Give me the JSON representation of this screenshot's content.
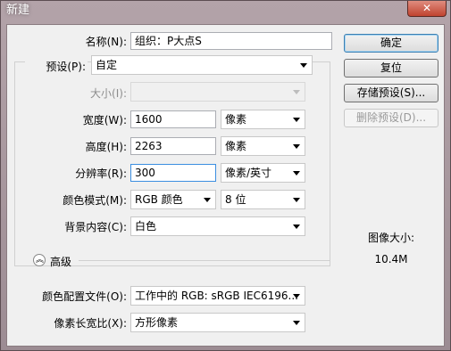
{
  "window": {
    "title": "新建",
    "close_glyph": "✕"
  },
  "fields": {
    "name": {
      "label": "名称(N):",
      "value": "组织：P大点S"
    },
    "preset": {
      "label": "预设(P):",
      "value": "自定"
    },
    "size": {
      "label": "大小(I):",
      "value": ""
    },
    "width": {
      "label": "宽度(W):",
      "value": "1600",
      "unit": "像素"
    },
    "height": {
      "label": "高度(H):",
      "value": "2263",
      "unit": "像素"
    },
    "resolution": {
      "label": "分辨率(R):",
      "value": "300",
      "unit": "像素/英寸"
    },
    "color_mode": {
      "label": "颜色模式(M):",
      "mode": "RGB 颜色",
      "depth": "8 位"
    },
    "background": {
      "label": "背景内容(C):",
      "value": "白色"
    },
    "advanced": {
      "label": "高级"
    },
    "color_profile": {
      "label": "颜色配置文件(O):",
      "value": "工作中的 RGB: sRGB IEC6196..."
    },
    "pixel_aspect": {
      "label": "像素长宽比(X):",
      "value": "方形像素"
    }
  },
  "buttons": {
    "ok": "确定",
    "reset": "复位",
    "save_preset": "存储预设(S)...",
    "delete_preset": "删除预设(D)..."
  },
  "image_size": {
    "label": "图像大小:",
    "value": "10.4M"
  }
}
